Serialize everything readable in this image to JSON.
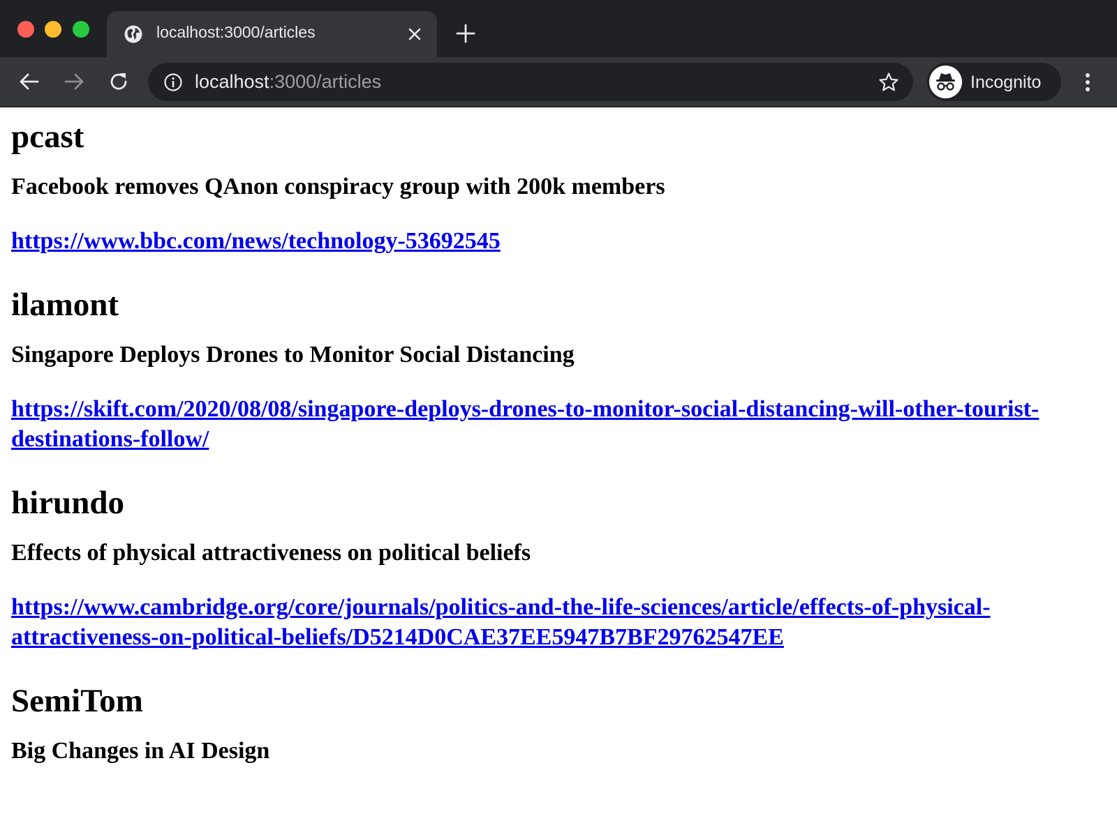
{
  "browser": {
    "tab": {
      "title": "localhost:3000/articles",
      "favicon": "globe-icon"
    },
    "address_bar": {
      "host": "localhost",
      "rest": ":3000/articles"
    },
    "profile": {
      "label": "Incognito"
    },
    "colors": {
      "frame": "#202124",
      "toolbar": "#35363a",
      "text": "#e8eaed",
      "link": "#0000ee"
    }
  },
  "articles": [
    {
      "author": "pcast",
      "title": "Facebook removes QAnon conspiracy group with 200k members",
      "url": "https://www.bbc.com/news/technology-53692545"
    },
    {
      "author": "ilamont",
      "title": "Singapore Deploys Drones to Monitor Social Distancing",
      "url": "https://skift.com/2020/08/08/singapore-deploys-drones-to-monitor-social-distancing-will-other-tourist-destinations-follow/"
    },
    {
      "author": "hirundo",
      "title": "Effects of physical attractiveness on political beliefs",
      "url": "https://www.cambridge.org/core/journals/politics-and-the-life-sciences/article/effects-of-physical-attractiveness-on-political-beliefs/D5214D0CAE37EE5947B7BF29762547EE"
    },
    {
      "author": "SemiTom",
      "title": "Big Changes in AI Design"
    }
  ]
}
